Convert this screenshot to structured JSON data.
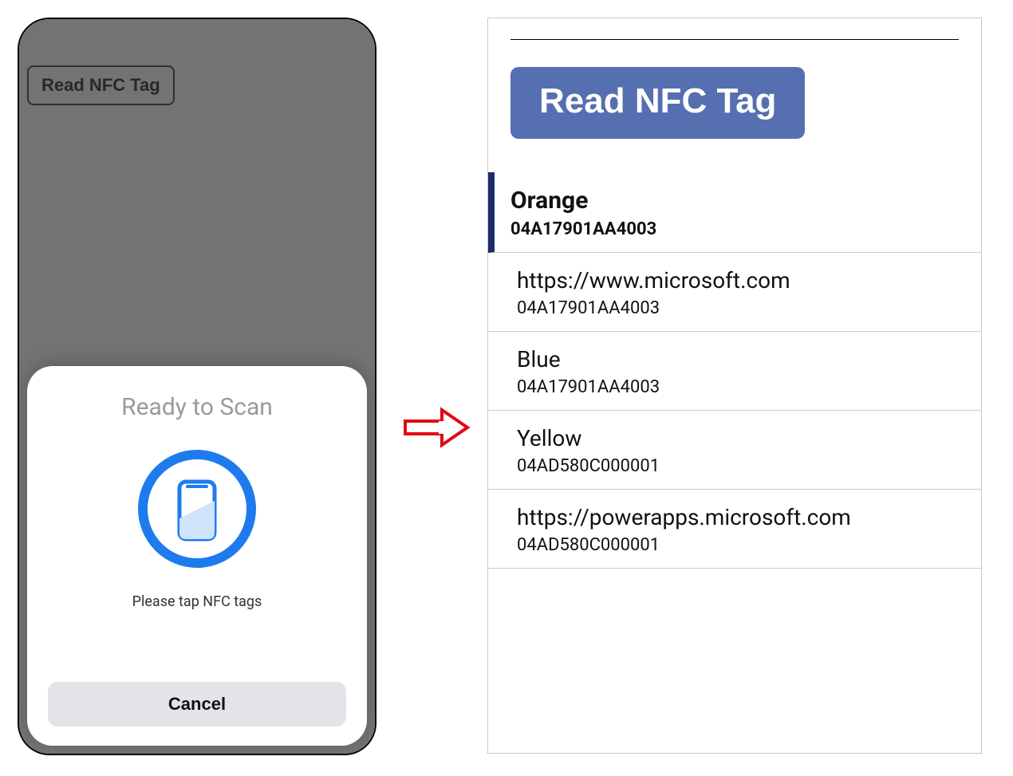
{
  "phone": {
    "button_label": "Read NFC Tag",
    "sheet": {
      "title": "Ready to Scan",
      "message": "Please tap NFC tags",
      "cancel_label": "Cancel"
    }
  },
  "panel": {
    "button_label": "Read NFC Tag",
    "items": [
      {
        "title": "Orange",
        "sub": "04A17901AA4003",
        "selected": true
      },
      {
        "title": "https://www.microsoft.com",
        "sub": "04A17901AA4003",
        "selected": false
      },
      {
        "title": "Blue",
        "sub": "04A17901AA4003",
        "selected": false
      },
      {
        "title": "Yellow",
        "sub": "04AD580C000001",
        "selected": false
      },
      {
        "title": "https://powerapps.microsoft.com",
        "sub": "04AD580C000001",
        "selected": false
      }
    ]
  }
}
